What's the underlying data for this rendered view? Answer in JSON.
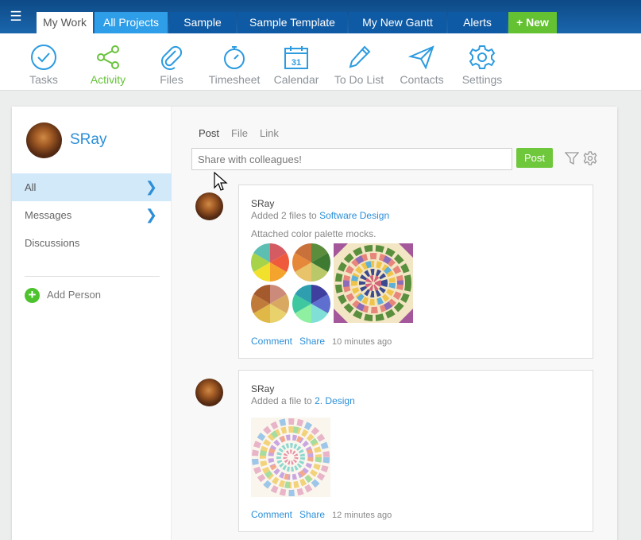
{
  "topbar": {
    "menu_icon": "hamburger-menu-icon",
    "tabs": [
      {
        "label": "My Work",
        "state": "active"
      },
      {
        "label": "All Projects",
        "state": "highlight"
      },
      {
        "label": "Sample",
        "state": "normal"
      },
      {
        "label": "Sample Template",
        "state": "normal"
      },
      {
        "label": "My New Gantt",
        "state": "normal"
      },
      {
        "label": "Alerts",
        "state": "normal"
      },
      {
        "label": "+ New",
        "state": "new"
      }
    ]
  },
  "toolbar": {
    "items": [
      {
        "label": "Tasks",
        "icon": "check-circle-icon"
      },
      {
        "label": "Activity",
        "icon": "share-nodes-icon",
        "active": true
      },
      {
        "label": "Files",
        "icon": "paperclip-icon"
      },
      {
        "label": "Timesheet",
        "icon": "stopwatch-icon"
      },
      {
        "label": "Calendar",
        "icon": "calendar-icon",
        "day": "31"
      },
      {
        "label": "To Do List",
        "icon": "pencil-icon"
      },
      {
        "label": "Contacts",
        "icon": "paper-plane-icon"
      },
      {
        "label": "Settings",
        "icon": "gear-icon"
      }
    ]
  },
  "sidebar": {
    "user": "SRay",
    "items": [
      {
        "label": "All",
        "selected": true,
        "chevron": true
      },
      {
        "label": "Messages",
        "selected": false,
        "chevron": true
      },
      {
        "label": "Discussions",
        "selected": false,
        "chevron": false
      }
    ],
    "add_person": "Add Person"
  },
  "composer": {
    "tabs": [
      "Post",
      "File",
      "Link"
    ],
    "placeholder": "Share with colleagues!",
    "post_button": "Post"
  },
  "feed": [
    {
      "author": "SRay",
      "action": "Added 2 files to",
      "target": "Software Design",
      "message": "Attached color palette mocks.",
      "comment": "Comment",
      "share": "Share",
      "time": "10 minutes ago"
    },
    {
      "author": "SRay",
      "action": "Added a file to",
      "target": "2. Design",
      "comment": "Comment",
      "share": "Share",
      "time": "12 minutes ago"
    }
  ],
  "colors": {
    "brand_blue": "#1b66ad",
    "link_blue": "#2c8fd8",
    "green": "#67c23a",
    "selected_bg": "#d2e9fa"
  }
}
